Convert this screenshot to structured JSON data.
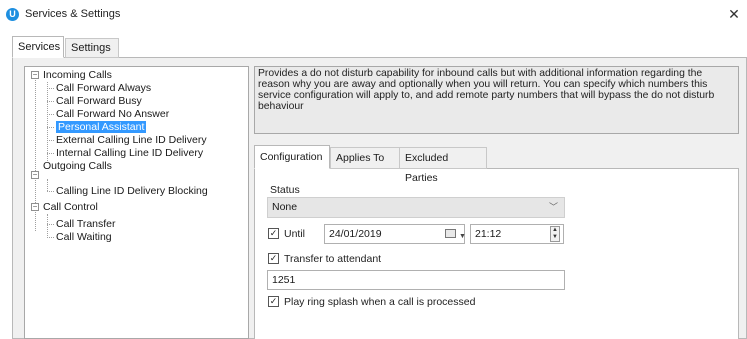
{
  "window": {
    "title": "Services & Settings",
    "close_glyph": "✕",
    "app_icon_glyph": "U"
  },
  "outer_tabs": [
    {
      "label": "Services"
    },
    {
      "label": "Settings"
    }
  ],
  "tree": {
    "incoming": {
      "label": "Incoming Calls",
      "expander": "⊟",
      "children": [
        {
          "label": "Call Forward Always"
        },
        {
          "label": "Call Forward Busy"
        },
        {
          "label": "Call Forward No Answer"
        },
        {
          "label": "Personal Assistant"
        },
        {
          "label": "External Calling Line ID Delivery"
        },
        {
          "label": "Internal Calling Line ID Delivery"
        }
      ]
    },
    "outgoing": {
      "label": "Outgoing Calls",
      "expander": "⊟",
      "children": [
        {
          "label": "Calling Line ID Delivery Blocking"
        }
      ]
    },
    "control": {
      "label": "Call Control",
      "expander": "⊟",
      "children": [
        {
          "label": "Call Transfer"
        },
        {
          "label": "Call Waiting"
        }
      ]
    }
  },
  "description": "Provides a do not disturb capability for inbound calls but with additional information regarding the reason why you are away and optionally when you will return. You can specify which numbers this service configuration will apply to, and add remote party numbers that will bypass the do not disturb behaviour",
  "inner_tabs": [
    {
      "label": "Configuration"
    },
    {
      "label": "Applies To"
    },
    {
      "label": "Excluded Parties"
    }
  ],
  "config": {
    "status_label": "Status",
    "status_value": "None",
    "until_label": "Until",
    "until_checked": "☑",
    "date_value": "24/01/2019",
    "time_value": "21:12",
    "transfer_label": "Transfer to attendant",
    "transfer_checked": "☑",
    "attendant_value": "1251",
    "ring_label": "Play ring splash when a call is processed",
    "ring_checked": "☑"
  }
}
